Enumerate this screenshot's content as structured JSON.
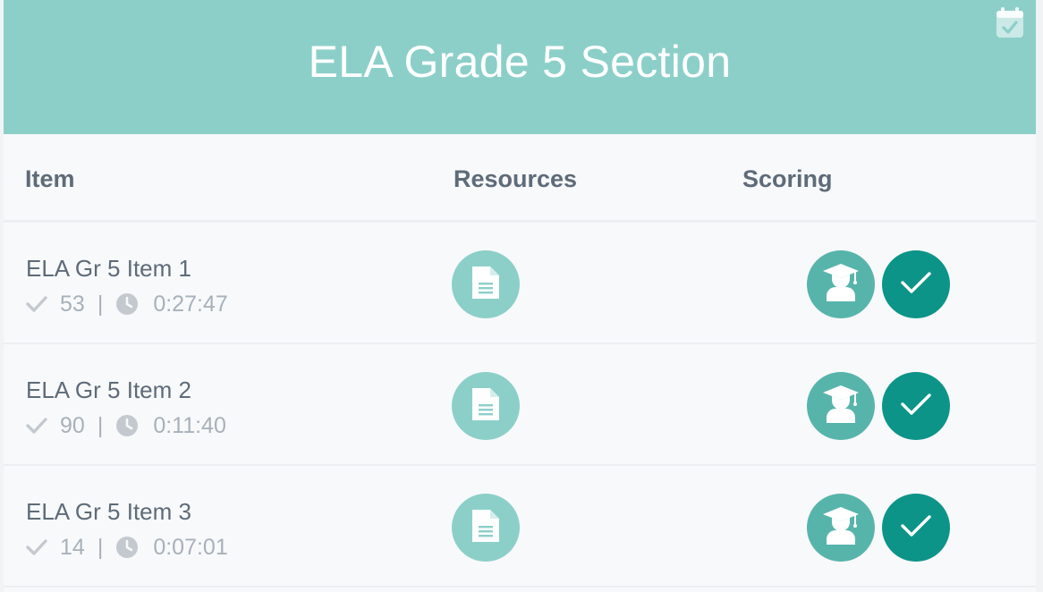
{
  "section": {
    "title": "ELA Grade 5 Section"
  },
  "columns": {
    "item": "Item",
    "resources": "Resources",
    "scoring": "Scoring"
  },
  "items": [
    {
      "name": "ELA Gr 5 Item 1",
      "score": "53",
      "time": "0:27:47"
    },
    {
      "name": "ELA Gr 5 Item 2",
      "score": "90",
      "time": "0:11:40"
    },
    {
      "name": "ELA Gr 5 Item 3",
      "score": "14",
      "time": "0:07:01"
    }
  ],
  "meta": {
    "separator": "|"
  },
  "icons": {
    "header": "calendar-check-icon",
    "score": "checkmark-icon",
    "time": "clock-icon",
    "resource": "document-icon",
    "student": "student-icon",
    "scored": "checkmark-icon"
  },
  "colors": {
    "header_bg": "#8ccfc9",
    "resource_btn": "#8ccfc9",
    "student_btn": "#57b4ab",
    "scored_btn": "#0d9488",
    "heading_text": "#5e6b78",
    "meta_text": "#a8b1ba"
  }
}
